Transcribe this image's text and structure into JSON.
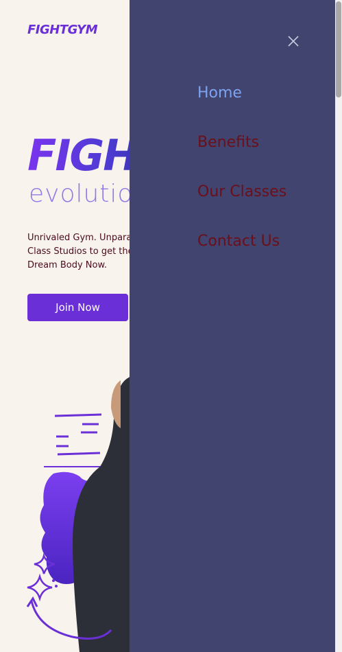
{
  "header": {
    "logo": "FIGHTGYM"
  },
  "hero": {
    "title": "FIGHT",
    "subtitle": "evolution",
    "description": "Unrivaled Gym. Unparalleled Training Fitness Class Studios to get the Best Body. Get Your Dream Body Now.",
    "cta_label": "Join Now"
  },
  "menu": {
    "close_icon": "close-icon",
    "items": [
      {
        "label": "Home",
        "active": true
      },
      {
        "label": "Benefits",
        "active": false
      },
      {
        "label": "Our Classes",
        "active": false
      },
      {
        "label": "Contact Us",
        "active": false
      }
    ]
  },
  "colors": {
    "page_bg": "#f8f3ec",
    "brand": "#6a2fd6",
    "drawer_bg": "#40446f",
    "menu_active": "#7ea3ee",
    "menu_text": "#6b0f1a",
    "body_text": "#4a0b1e"
  }
}
